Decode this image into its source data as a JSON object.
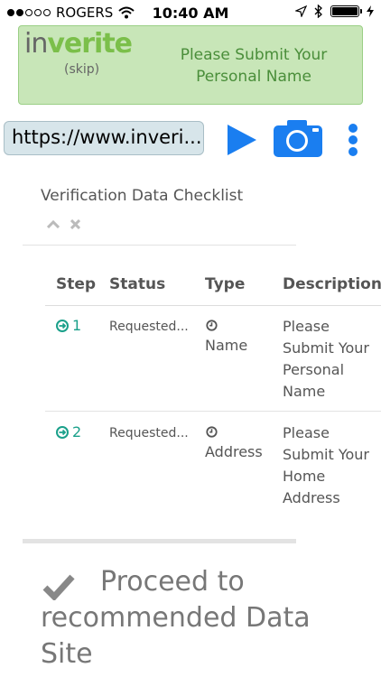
{
  "status_bar": {
    "carrier": "ROGERS",
    "time": "10:40 AM"
  },
  "banner": {
    "logo_in": "in",
    "logo_verite": "verite",
    "skip": "(skip)",
    "message": "Please Submit Your Personal Name"
  },
  "toolbar": {
    "url": "https://www.inveri..."
  },
  "checklist": {
    "title": "Verification Data Checklist",
    "headers": {
      "step": "Step",
      "status": "Status",
      "type": "Type",
      "description": "Description"
    },
    "rows": [
      {
        "step": "1",
        "status": "Requested...",
        "type": "Name",
        "description": "Please Submit Your Personal Name"
      },
      {
        "step": "2",
        "status": "Requested...",
        "type": "Address",
        "description": "Please Submit Your Home Address"
      }
    ]
  },
  "proceed": {
    "label_line1": "Proceed to",
    "label_line2": "recommended Data Site"
  },
  "colors": {
    "brand_green": "#7bbf4a",
    "banner_bg": "#c8e6b8",
    "accent_blue": "#1a7ef0",
    "step_teal": "#1aa08a"
  },
  "icons": [
    "wifi-icon",
    "location-icon",
    "bluetooth-icon",
    "battery-icon",
    "play-icon",
    "camera-icon",
    "more-vertical-icon",
    "chevron-up-icon",
    "close-icon",
    "arrow-circle-right-icon",
    "clock-icon",
    "checkmark-icon"
  ]
}
